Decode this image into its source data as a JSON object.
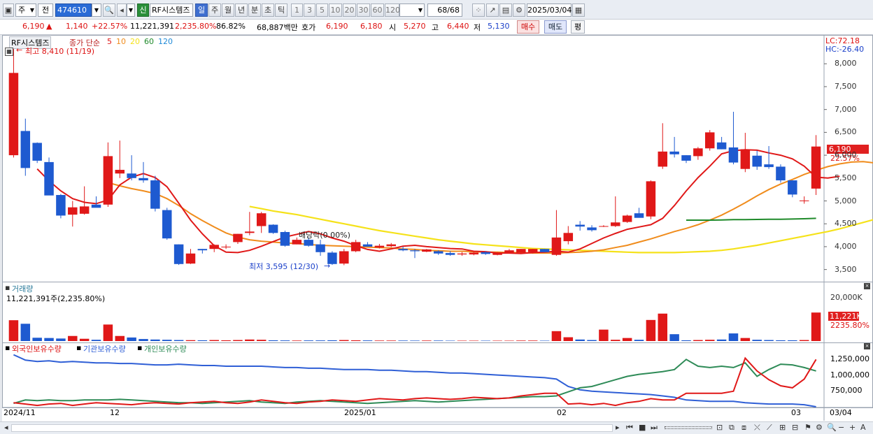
{
  "toolbar": {
    "market": "주",
    "prev": "전",
    "code": "474610",
    "name_badge": "신",
    "name": "RF시스템즈",
    "periods": [
      "일",
      "주",
      "월",
      "년",
      "분",
      "초",
      "틱"
    ],
    "active_period": "일",
    "intervals": [
      "1",
      "3",
      "5",
      "10",
      "20",
      "30",
      "60",
      "120"
    ],
    "count": "68/68",
    "date": "2025/03/04"
  },
  "info": {
    "price": "6,190",
    "change": "1,140",
    "change_pct": "+22.57%",
    "volume": "11,221,391",
    "volume_pct": "2,235.80%",
    "turnover_pct": "86.82%",
    "amount": "68,887백만",
    "ask_label": "호가",
    "ask": "6,190",
    "bid": "6,180",
    "open_label": "시",
    "open": "5,270",
    "high_label": "고",
    "high": "6,440",
    "low_label": "저",
    "low": "5,130",
    "buy": "매수",
    "sell": "매도",
    "avg": "평"
  },
  "price_panel": {
    "stock_label": "RF시스템즈",
    "ma_label": "종가 단순",
    "ma_periods": [
      "5",
      "10",
      "20",
      "60",
      "120"
    ],
    "ma_colors": [
      "#e01818",
      "#f08c1c",
      "#f5e21a",
      "#1f8a2a",
      "#1f8ad8"
    ],
    "high_note": "최고 8,410 (11/19)",
    "low_note": "최저 3,595 (12/30)",
    "dividend_note": "배당락(0.00%)",
    "lc": "LC:72.18",
    "hc": "HC:-26.40",
    "last_price_tag": "6,190",
    "last_pct_tag": "22.57%",
    "y_ticks": [
      "8,000",
      "7,500",
      "7,000",
      "6,500",
      "6,000",
      "5,500",
      "5,000",
      "4,500",
      "4,000",
      "3,500"
    ]
  },
  "volume_panel": {
    "title": "거래량",
    "summary": "11,221,391주(2,235.80%)",
    "y_tick": "20,000K",
    "last_tag": "11,221K",
    "last_pct": "2235.80%"
  },
  "holding_panel": {
    "legend": [
      "외국인보유수량",
      "기관보유수량",
      "개인보유수량"
    ],
    "colors": [
      "#e01818",
      "#2f5fd6",
      "#2e8b57"
    ],
    "y_ticks": [
      "1,250,000",
      "1,000,000",
      "750,000"
    ]
  },
  "x_axis": {
    "labels": [
      "2024/11",
      "12",
      "2025/01",
      "02",
      "03"
    ],
    "right_label": "03/04"
  },
  "chart_data": {
    "type": "candlestick",
    "dates_note": "daily, 2024/11 to 2025/03/04",
    "candles": [
      {
        "o": 6000,
        "h": 8410,
        "l": 5950,
        "c": 7800
      },
      {
        "o": 6530,
        "h": 6800,
        "l": 5550,
        "c": 5720
      },
      {
        "o": 6270,
        "h": 6280,
        "l": 5830,
        "c": 5880
      },
      {
        "o": 5850,
        "h": 5950,
        "l": 5150,
        "c": 5120
      },
      {
        "o": 5130,
        "h": 5150,
        "l": 4620,
        "c": 4680
      },
      {
        "o": 4700,
        "h": 5000,
        "l": 4440,
        "c": 4860
      },
      {
        "o": 4720,
        "h": 5320,
        "l": 4700,
        "c": 4880
      },
      {
        "o": 4920,
        "h": 5100,
        "l": 4870,
        "c": 4850
      },
      {
        "o": 4920,
        "h": 6280,
        "l": 4870,
        "c": 5980
      },
      {
        "o": 5600,
        "h": 6320,
        "l": 5500,
        "c": 5680
      },
      {
        "o": 5600,
        "h": 6000,
        "l": 5450,
        "c": 5500
      },
      {
        "o": 5500,
        "h": 5850,
        "l": 5400,
        "c": 5450
      },
      {
        "o": 5450,
        "h": 5550,
        "l": 4770,
        "c": 4830
      },
      {
        "o": 4800,
        "h": 4850,
        "l": 4150,
        "c": 4180
      },
      {
        "o": 4050,
        "h": 4050,
        "l": 3600,
        "c": 3620
      },
      {
        "o": 3630,
        "h": 3950,
        "l": 3620,
        "c": 3850
      },
      {
        "o": 3950,
        "h": 3950,
        "l": 3850,
        "c": 3920
      },
      {
        "o": 3950,
        "h": 4050,
        "l": 3880,
        "c": 4040
      },
      {
        "o": 4000,
        "h": 4050,
        "l": 3950,
        "c": 4000
      },
      {
        "o": 4100,
        "h": 4280,
        "l": 4060,
        "c": 4280
      },
      {
        "o": 4300,
        "h": 4760,
        "l": 4250,
        "c": 4330
      },
      {
        "o": 4450,
        "h": 4760,
        "l": 4300,
        "c": 4730
      },
      {
        "o": 4480,
        "h": 4490,
        "l": 4280,
        "c": 4300
      },
      {
        "o": 4320,
        "h": 4350,
        "l": 4000,
        "c": 4020
      },
      {
        "o": 4050,
        "h": 4200,
        "l": 4050,
        "c": 4150
      },
      {
        "o": 4150,
        "h": 4200,
        "l": 4000,
        "c": 4020
      },
      {
        "o": 4050,
        "h": 4150,
        "l": 3800,
        "c": 3880
      },
      {
        "o": 3870,
        "h": 3900,
        "l": 3600,
        "c": 3620
      },
      {
        "o": 3630,
        "h": 3950,
        "l": 3595,
        "c": 3900
      },
      {
        "o": 3900,
        "h": 4150,
        "l": 3880,
        "c": 4100
      },
      {
        "o": 4050,
        "h": 4100,
        "l": 4000,
        "c": 4000
      },
      {
        "o": 3980,
        "h": 4060,
        "l": 3960,
        "c": 4020
      },
      {
        "o": 4010,
        "h": 4080,
        "l": 3990,
        "c": 4050
      },
      {
        "o": 3950,
        "h": 4000,
        "l": 3900,
        "c": 3920
      },
      {
        "o": 3920,
        "h": 3950,
        "l": 3750,
        "c": 3900
      },
      {
        "o": 3890,
        "h": 3950,
        "l": 3880,
        "c": 3940
      },
      {
        "o": 3900,
        "h": 3920,
        "l": 3820,
        "c": 3850
      },
      {
        "o": 3860,
        "h": 3900,
        "l": 3800,
        "c": 3820
      },
      {
        "o": 3830,
        "h": 3880,
        "l": 3800,
        "c": 3850
      },
      {
        "o": 3830,
        "h": 3880,
        "l": 3810,
        "c": 3870
      },
      {
        "o": 3880,
        "h": 3900,
        "l": 3820,
        "c": 3840
      },
      {
        "o": 3820,
        "h": 3880,
        "l": 3810,
        "c": 3870
      },
      {
        "o": 3870,
        "h": 3950,
        "l": 3850,
        "c": 3920
      },
      {
        "o": 3870,
        "h": 3950,
        "l": 3850,
        "c": 3950
      },
      {
        "o": 3880,
        "h": 3950,
        "l": 3850,
        "c": 3950
      },
      {
        "o": 3950,
        "h": 3950,
        "l": 3880,
        "c": 3880
      },
      {
        "o": 3820,
        "h": 4800,
        "l": 3800,
        "c": 4200
      },
      {
        "o": 4120,
        "h": 4450,
        "l": 4050,
        "c": 4300
      },
      {
        "o": 4480,
        "h": 4560,
        "l": 4350,
        "c": 4440
      },
      {
        "o": 4420,
        "h": 4470,
        "l": 4330,
        "c": 4360
      },
      {
        "o": 4450,
        "h": 4470,
        "l": 4430,
        "c": 4450
      },
      {
        "o": 4450,
        "h": 5100,
        "l": 4430,
        "c": 4530
      },
      {
        "o": 4540,
        "h": 4700,
        "l": 4520,
        "c": 4680
      },
      {
        "o": 4730,
        "h": 4850,
        "l": 4650,
        "c": 4630
      },
      {
        "o": 4660,
        "h": 5450,
        "l": 4600,
        "c": 5430
      },
      {
        "o": 5750,
        "h": 6700,
        "l": 5700,
        "c": 6080
      },
      {
        "o": 6080,
        "h": 6400,
        "l": 5950,
        "c": 6020
      },
      {
        "o": 6000,
        "h": 6000,
        "l": 5830,
        "c": 5880
      },
      {
        "o": 5980,
        "h": 6180,
        "l": 5900,
        "c": 6150
      },
      {
        "o": 6150,
        "h": 6550,
        "l": 6100,
        "c": 6500
      },
      {
        "o": 6280,
        "h": 6400,
        "l": 6130,
        "c": 6130
      },
      {
        "o": 6170,
        "h": 6950,
        "l": 5800,
        "c": 5840
      },
      {
        "o": 5700,
        "h": 6490,
        "l": 5630,
        "c": 6130
      },
      {
        "o": 5990,
        "h": 6100,
        "l": 5680,
        "c": 5750
      },
      {
        "o": 5800,
        "h": 6200,
        "l": 5700,
        "c": 5740
      },
      {
        "o": 5750,
        "h": 5800,
        "l": 5400,
        "c": 5450
      },
      {
        "o": 5450,
        "h": 5450,
        "l": 5080,
        "c": 5140
      },
      {
        "o": 5010,
        "h": 5100,
        "l": 4940,
        "c": 5010
      },
      {
        "o": 5270,
        "h": 6440,
        "l": 5130,
        "c": 6190
      }
    ],
    "volume_k": [
      8200,
      6800,
      1300,
      1200,
      1000,
      2000,
      900,
      500,
      6500,
      2000,
      1400,
      800,
      600,
      500,
      400,
      350,
      300,
      400,
      300,
      400,
      600,
      500,
      300,
      250,
      200,
      250,
      250,
      300,
      400,
      300,
      250,
      200,
      200,
      200,
      180,
      200,
      200,
      150,
      150,
      150,
      150,
      150,
      150,
      200,
      200,
      150,
      3900,
      1500,
      600,
      400,
      4500,
      500,
      1200,
      500,
      8300,
      10800,
      2700,
      300,
      400,
      500,
      600,
      3000,
      1200,
      500,
      400,
      300,
      300,
      400,
      11221
    ],
    "ma5_start": 2,
    "ma5": [
      5700,
      5440,
      5220,
      5050,
      4970,
      4940,
      5020,
      5350,
      5520,
      5600,
      5510,
      5310,
      4950,
      4580,
      4280,
      4020,
      3880,
      3870,
      3920,
      4010,
      4110,
      4210,
      4270,
      4330,
      4280,
      4190,
      4120,
      4020,
      3940,
      3900,
      3950,
      4010,
      4030,
      4000,
      3980,
      3960,
      3950,
      3900,
      3890,
      3860,
      3860,
      3850,
      3870,
      3880,
      3900,
      3880,
      3950,
      4070,
      4190,
      4290,
      4380,
      4430,
      4480,
      4620,
      4900,
      5220,
      5510,
      5760,
      6030,
      6100,
      6120,
      6110,
      6050,
      6000,
      5920,
      5760,
      5520,
      5500,
      5540
    ],
    "ma20_start": 8,
    "ma20": [
      5400,
      5330,
      5270,
      5220,
      5160,
      5050,
      4900,
      4720,
      4570,
      4430,
      4300,
      4210,
      4150,
      4120,
      4100,
      4080,
      4070,
      4050,
      4030,
      4020,
      4010,
      4000,
      3990,
      3980,
      3970,
      3950,
      3940,
      3920,
      3910,
      3900,
      3900,
      3890,
      3880,
      3880,
      3870,
      3870,
      3860,
      3860,
      3860,
      3870,
      3880,
      3900,
      3930,
      3980,
      4030,
      4100,
      4170,
      4250,
      4330,
      4400,
      4480,
      4580,
      4690,
      4820,
      4960,
      5110,
      5250,
      5370,
      5470,
      5580,
      5670,
      5750,
      5810,
      5850,
      5860,
      5830,
      5810,
      5820
    ],
    "ma60_start": 20,
    "ma60": [
      4880,
      4830,
      4780,
      4740,
      4700,
      4650,
      4600,
      4550,
      4500,
      4450,
      4400,
      4350,
      4310,
      4270,
      4230,
      4190,
      4150,
      4120,
      4090,
      4060,
      4040,
      4020,
      4000,
      3980,
      3960,
      3950,
      3940,
      3930,
      3920,
      3910,
      3900,
      3890,
      3880,
      3870,
      3870,
      3870,
      3870,
      3880,
      3890,
      3900,
      3920,
      3950,
      3990,
      4030,
      4080,
      4130,
      4180,
      4230,
      4280,
      4330,
      4390,
      4460,
      4530,
      4600,
      4680,
      4760,
      4850,
      4940,
      5020,
      5100,
      5170,
      5240,
      5310,
      5370,
      5420,
      5460,
      5500,
      5540
    ],
    "ma120_start": 57,
    "ma120": [
      4580,
      4580,
      4580,
      4585,
      4590,
      4590,
      4595,
      4600,
      4600,
      4605,
      4610,
      4620
    ]
  },
  "holding_data": {
    "y_range": [
      600000,
      1500000
    ],
    "foreign": [
      660000,
      640000,
      620000,
      640000,
      650000,
      620000,
      640000,
      660000,
      650000,
      640000,
      630000,
      650000,
      660000,
      650000,
      640000,
      660000,
      670000,
      680000,
      660000,
      650000,
      670000,
      700000,
      680000,
      660000,
      650000,
      670000,
      680000,
      700000,
      690000,
      680000,
      700000,
      720000,
      710000,
      700000,
      720000,
      730000,
      720000,
      710000,
      720000,
      740000,
      730000,
      720000,
      730000,
      760000,
      780000,
      800000,
      800000,
      640000,
      650000,
      630000,
      650000,
      620000,
      660000,
      680000,
      720000,
      700000,
      700000,
      800000,
      800000,
      800000,
      800000,
      830000,
      1320000,
      1130000,
      1000000,
      910000,
      880000,
      1010000,
      1300000
    ],
    "institution": [
      1370000,
      1290000,
      1270000,
      1280000,
      1260000,
      1270000,
      1260000,
      1250000,
      1250000,
      1240000,
      1240000,
      1230000,
      1220000,
      1220000,
      1230000,
      1220000,
      1210000,
      1210000,
      1200000,
      1200000,
      1200000,
      1200000,
      1190000,
      1180000,
      1180000,
      1170000,
      1170000,
      1160000,
      1150000,
      1150000,
      1150000,
      1140000,
      1140000,
      1130000,
      1120000,
      1120000,
      1110000,
      1100000,
      1100000,
      1090000,
      1080000,
      1070000,
      1060000,
      1050000,
      1040000,
      1030000,
      1010000,
      900000,
      850000,
      830000,
      820000,
      810000,
      800000,
      790000,
      780000,
      760000,
      740000,
      700000,
      690000,
      680000,
      680000,
      680000,
      660000,
      650000,
      640000,
      640000,
      640000,
      630000,
      600000
    ],
    "individual": [
      650000,
      700000,
      690000,
      700000,
      690000,
      690000,
      700000,
      700000,
      700000,
      710000,
      700000,
      690000,
      680000,
      670000,
      660000,
      660000,
      650000,
      660000,
      670000,
      680000,
      690000,
      670000,
      660000,
      650000,
      670000,
      680000,
      690000,
      680000,
      670000,
      660000,
      650000,
      660000,
      670000,
      680000,
      690000,
      680000,
      670000,
      680000,
      690000,
      700000,
      710000,
      720000,
      730000,
      740000,
      750000,
      750000,
      760000,
      820000,
      880000,
      900000,
      950000,
      1000000,
      1050000,
      1080000,
      1100000,
      1120000,
      1150000,
      1300000,
      1200000,
      1180000,
      1200000,
      1180000,
      1250000,
      1050000,
      1150000,
      1230000,
      1220000,
      1180000,
      1130000
    ]
  }
}
